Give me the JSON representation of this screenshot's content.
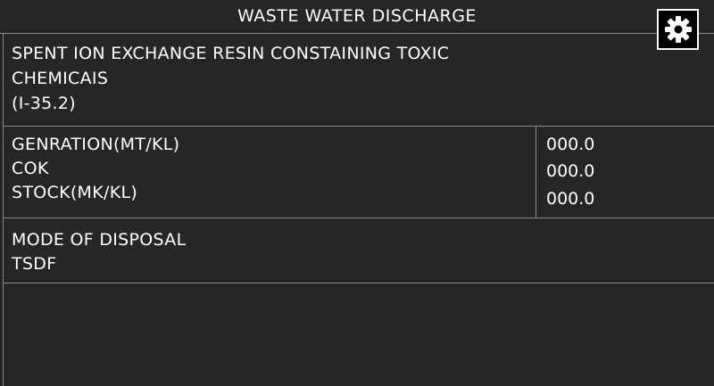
{
  "header": {
    "title": "WASTE WATER DISCHARGE",
    "settings_icon": "gear-icon"
  },
  "chemical": {
    "line1": "SPENT ION EXCHANGE RESIN CONSTAINING TOXIC",
    "line2": "CHEMICAIS",
    "code": "(I-35.2)"
  },
  "metrics": [
    {
      "label": "GENRATION(MT/KL)",
      "value": "000.0"
    },
    {
      "label": "COK",
      "value": "000.0"
    },
    {
      "label": "STOCK(MK/KL)",
      "value": "000.0"
    }
  ],
  "disposal": {
    "label": "MODE OF DISPOSAL",
    "value": "TSDF"
  },
  "colors": {
    "background": "#262626",
    "border": "#8a8a8a",
    "text": "#ffffff",
    "button_bg": "#000000"
  }
}
